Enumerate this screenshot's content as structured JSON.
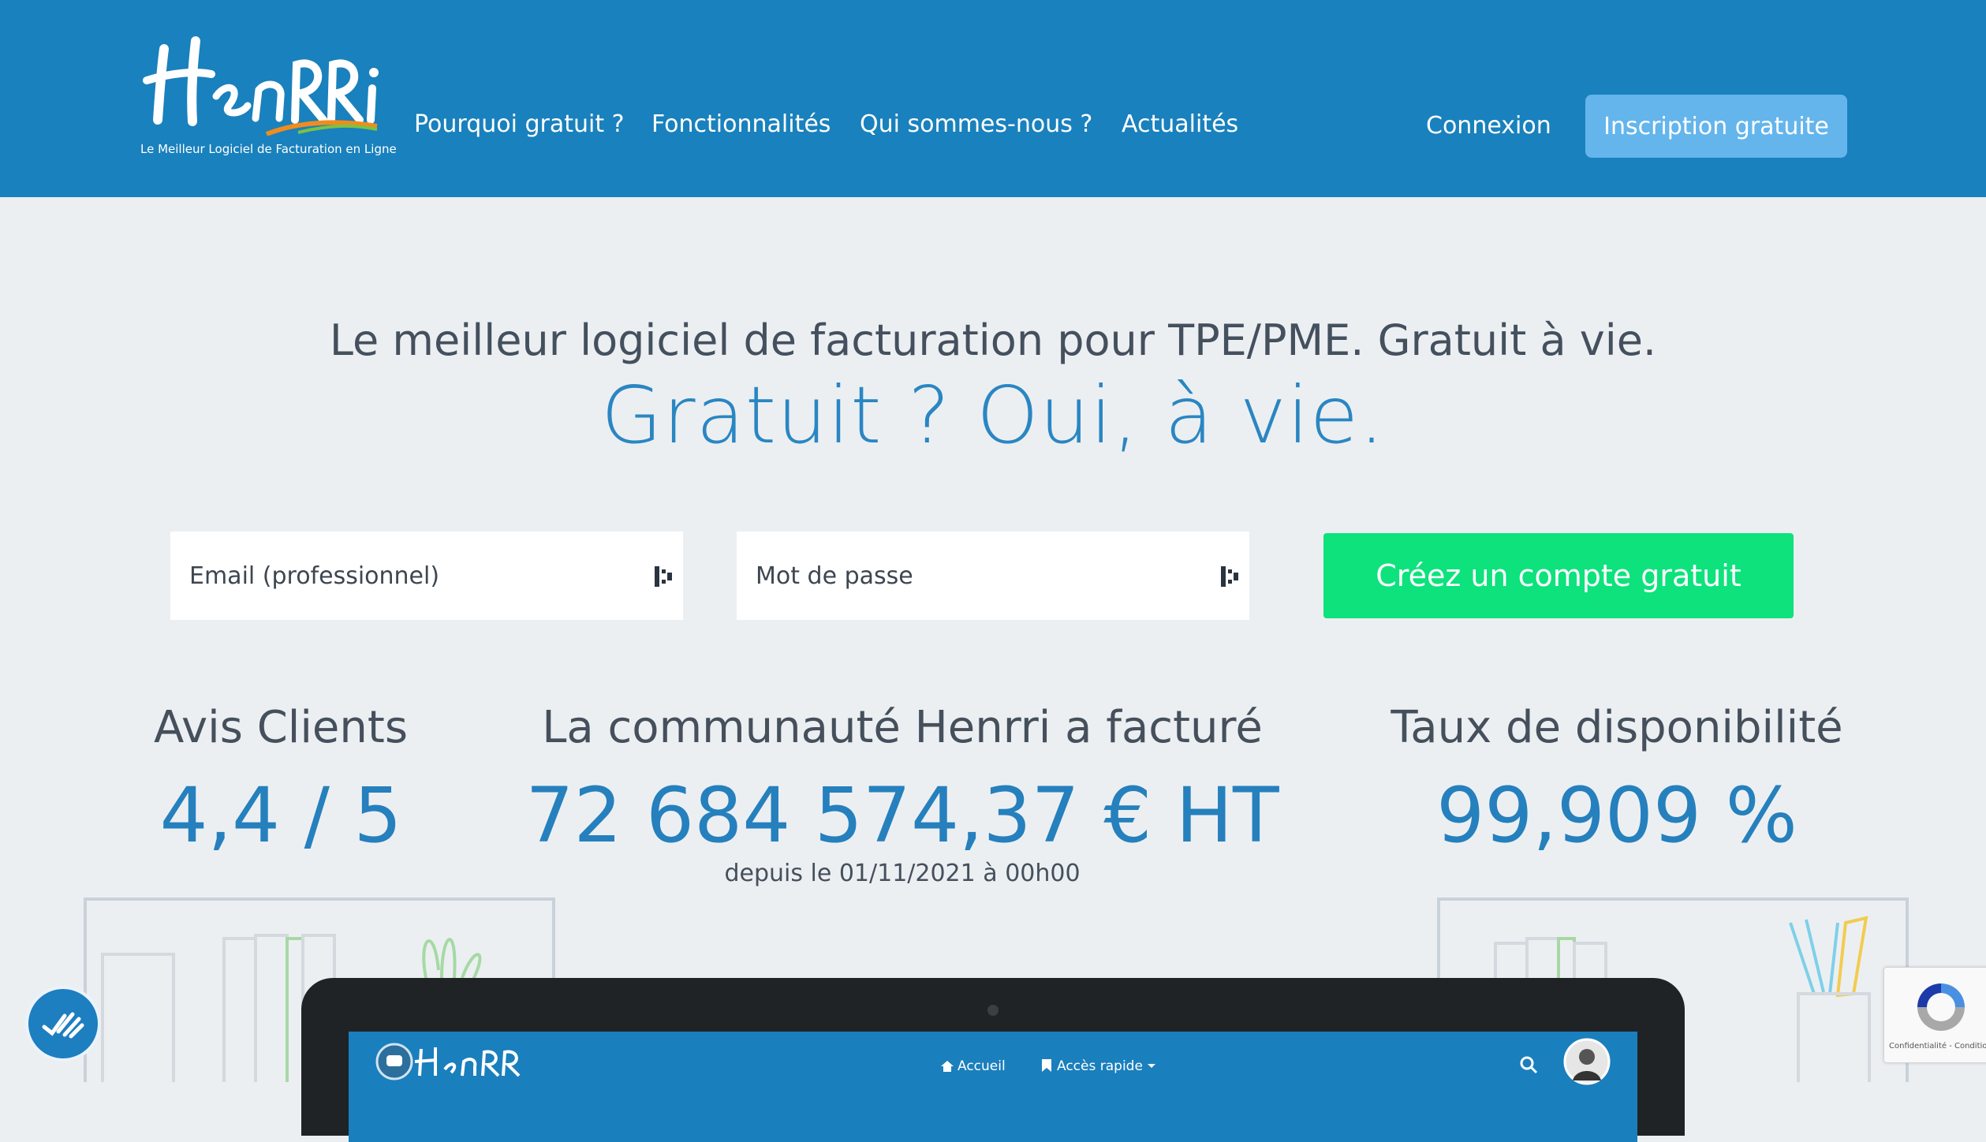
{
  "header": {
    "logo_tagline": "Le Meilleur Logiciel de Facturation en Ligne",
    "nav": [
      "Pourquoi gratuit ?",
      "Fonctionnalités",
      "Qui sommes-nous ?",
      "Actualités"
    ],
    "login": "Connexion",
    "signup": "Inscription gratuite"
  },
  "hero": {
    "subtitle": "Le meilleur logiciel de facturation pour TPE/PME. Gratuit à vie.",
    "title": "Gratuit ? Oui, à vie."
  },
  "form": {
    "email_placeholder": "Email (professionnel)",
    "password_placeholder": "Mot de passe",
    "cta": "Créez un compte gratuit"
  },
  "stats": {
    "reviews_label": "Avis Clients",
    "reviews_value": "4,4 / 5",
    "billed_label": "La communauté Henrri a facturé",
    "billed_value": "72 684 574,37 € HT",
    "billed_since": "depuis le 01/11/2021 à 00h00",
    "uptime_label": "Taux de disponibilité",
    "uptime_value": "99,909 %"
  },
  "app_preview": {
    "nav_home": "Accueil",
    "nav_quick": "Accès rapide"
  },
  "recaptcha": {
    "text": "Confidentialité - Conditions"
  },
  "colors": {
    "header_bg": "#1981bd",
    "cta_green": "#0de27c",
    "signup_button": "#64b5ec",
    "accent_blue": "#2a86c2"
  }
}
